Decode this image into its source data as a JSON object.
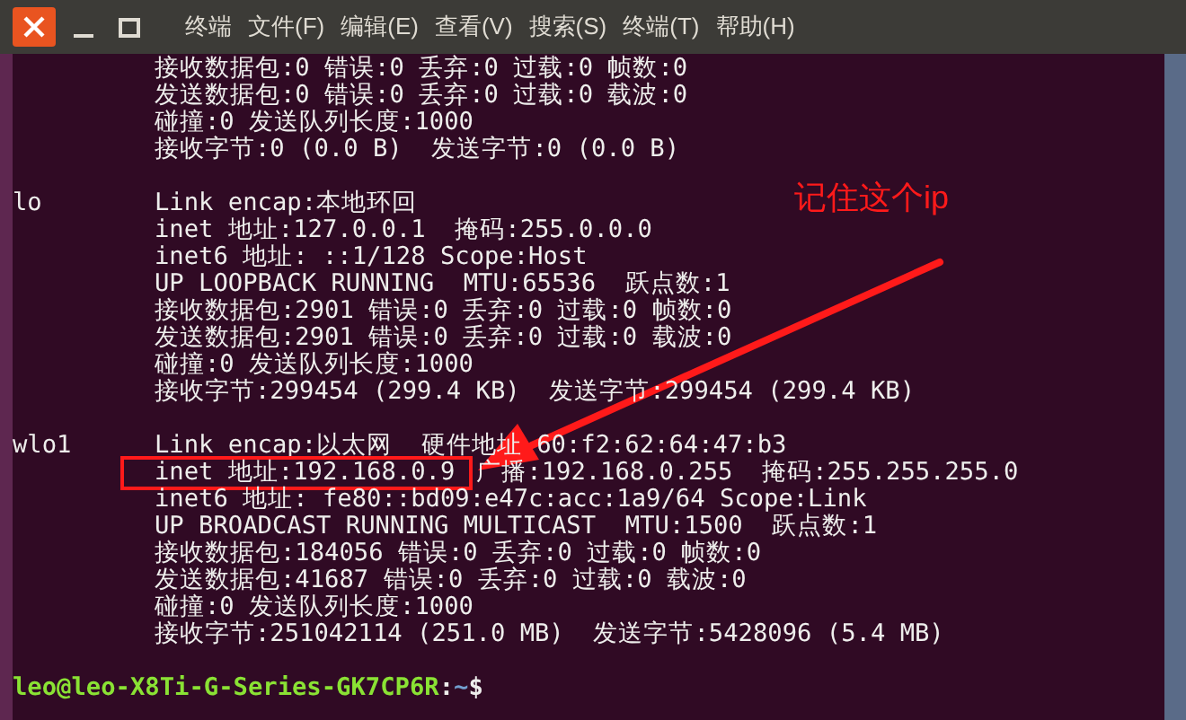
{
  "menu": [
    "终端",
    "文件(F)",
    "编辑(E)",
    "查看(V)",
    "搜索(S)",
    "终端(T)",
    "帮助(H)"
  ],
  "interfaces": [
    {
      "lines": [
        {
          "kind": "plain",
          "text": "接收数据包:0 错误:0 丢弃:0 过载:0 帧数:0"
        },
        {
          "kind": "plain",
          "text": "发送数据包:0 错误:0 丢弃:0 过载:0 载波:0"
        },
        {
          "kind": "plain",
          "text": "碰撞:0 发送队列长度:1000"
        },
        {
          "kind": "plain",
          "text": "接收字节:0 (0.0 B)  发送字节:0 (0.0 B)"
        }
      ]
    },
    {
      "name": "lo",
      "lines": [
        {
          "kind": "plain",
          "text": "Link encap:本地环回"
        },
        {
          "kind": "plain",
          "text": "inet 地址:127.0.0.1  掩码:255.0.0.0"
        },
        {
          "kind": "plain",
          "text": "inet6 地址: ::1/128 Scope:Host"
        },
        {
          "kind": "plain",
          "text": "UP LOOPBACK RUNNING  MTU:65536  跃点数:1"
        },
        {
          "kind": "plain",
          "text": "接收数据包:2901 错误:0 丢弃:0 过载:0 帧数:0"
        },
        {
          "kind": "plain",
          "text": "发送数据包:2901 错误:0 丢弃:0 过载:0 载波:0"
        },
        {
          "kind": "plain",
          "text": "碰撞:0 发送队列长度:1000"
        },
        {
          "kind": "plain",
          "text": "接收字节:299454 (299.4 KB)  发送字节:299454 (299.4 KB)"
        }
      ]
    },
    {
      "name": "wlo1",
      "lines": [
        {
          "kind": "plain",
          "text": "Link encap:以太网  硬件地址 60:f2:62:64:47:b3"
        },
        {
          "kind": "boxed",
          "boxed_text": "inet 地址:192.168.0.9",
          "text": "广播:192.168.0.255  掩码:255.255.255.0"
        },
        {
          "kind": "plain",
          "text": "inet6 地址: fe80::bd09:e47c:acc:1a9/64 Scope:Link"
        },
        {
          "kind": "plain",
          "text": "UP BROADCAST RUNNING MULTICAST  MTU:1500  跃点数:1"
        },
        {
          "kind": "plain",
          "text": "接收数据包:184056 错误:0 丢弃:0 过载:0 帧数:0"
        },
        {
          "kind": "plain",
          "text": "发送数据包:41687 错误:0 丢弃:0 过载:0 载波:0"
        },
        {
          "kind": "plain",
          "text": "碰撞:0 发送队列长度:1000"
        },
        {
          "kind": "plain",
          "text": "接收字节:251042114 (251.0 MB)  发送字节:5428096 (5.4 MB)"
        }
      ]
    }
  ],
  "prompt": {
    "user_host": "leo@leo-X8Ti-G-Series-GK7CP6R",
    "separator": ":",
    "path": "~",
    "symbol": "$"
  },
  "annotation": {
    "note": "记住这个ip"
  }
}
